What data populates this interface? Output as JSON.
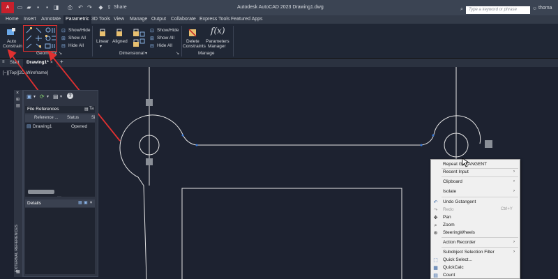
{
  "titlebar": {
    "logo": "A CAD",
    "share": "Share",
    "app_title": "Autodesk AutoCAD 2023   Drawing1.dwg",
    "search_placeholder": "Type a keyword or phrase",
    "user": "thoma"
  },
  "ribbon_tabs": [
    "Home",
    "Insert",
    "Annotate",
    "Parametric",
    "3D Tools",
    "View",
    "Manage",
    "Output",
    "Collaborate",
    "Express Tools",
    "Featured Apps"
  ],
  "ribbon": {
    "auto_constrain": [
      "Auto",
      "Constrain"
    ],
    "geometric_show_hide": "Show/Hide",
    "geometric_show_all": "Show All",
    "geometric_hide_all": "Hide All",
    "geometric_panel": "Geometric",
    "linear": "Linear",
    "aligned": "Aligned",
    "dimensional_show_hide": "Show/Hide",
    "dimensional_show_all": "Show All",
    "dimensional_hide_all": "Hide All",
    "dimensional_panel": "Dimensional",
    "delete_constraints": [
      "Delete",
      "Constraints"
    ],
    "parameters_manager": [
      "Parameters",
      "Manager"
    ],
    "manage_panel": "Manage"
  },
  "doc_tabs": {
    "start": "Start",
    "drawing": "Drawing1*"
  },
  "viewport_label": "[−][Top][2D Wireframe]",
  "palette": {
    "file_references_title": "File References",
    "col_reference": "Reference ...",
    "col_status": "Status",
    "col_size": "Si",
    "row_name": "Drawing1",
    "row_status": "Opened",
    "details": "Details",
    "side_label": "EXTERNAL REFERENCES",
    "col_t": "Ta"
  },
  "context_menu": {
    "items": [
      {
        "label": "Repeat GCTANGENT",
        "submenu": false,
        "disabled": false
      },
      {
        "label": "Recent Input",
        "submenu": true,
        "disabled": false
      },
      {
        "label": "Clipboard",
        "submenu": true,
        "disabled": false
      },
      {
        "label": "Isolate",
        "submenu": true,
        "disabled": false
      },
      {
        "label": "Undo Gctangent",
        "submenu": false,
        "disabled": false
      },
      {
        "label": "Redo",
        "submenu": false,
        "disabled": true,
        "shortcut": "Ctrl+Y"
      },
      {
        "label": "Pan",
        "submenu": false,
        "disabled": false
      },
      {
        "label": "Zoom",
        "submenu": false,
        "disabled": false
      },
      {
        "label": "SteeringWheels",
        "submenu": false,
        "disabled": false
      },
      {
        "label": "Action Recorder",
        "submenu": true,
        "disabled": false
      },
      {
        "label": "Subobject Selection Filter",
        "submenu": true,
        "disabled": false
      },
      {
        "label": "Quick Select...",
        "submenu": false,
        "disabled": false
      },
      {
        "label": "QuickCalc",
        "submenu": false,
        "disabled": false
      },
      {
        "label": "Count",
        "submenu": false,
        "disabled": false
      }
    ]
  },
  "colors": {
    "annotation_red": "#e03030",
    "canvas_bg": "#1d2230",
    "geometry": "#e6e6e6",
    "constraint_marker": "#3a7ad8"
  }
}
